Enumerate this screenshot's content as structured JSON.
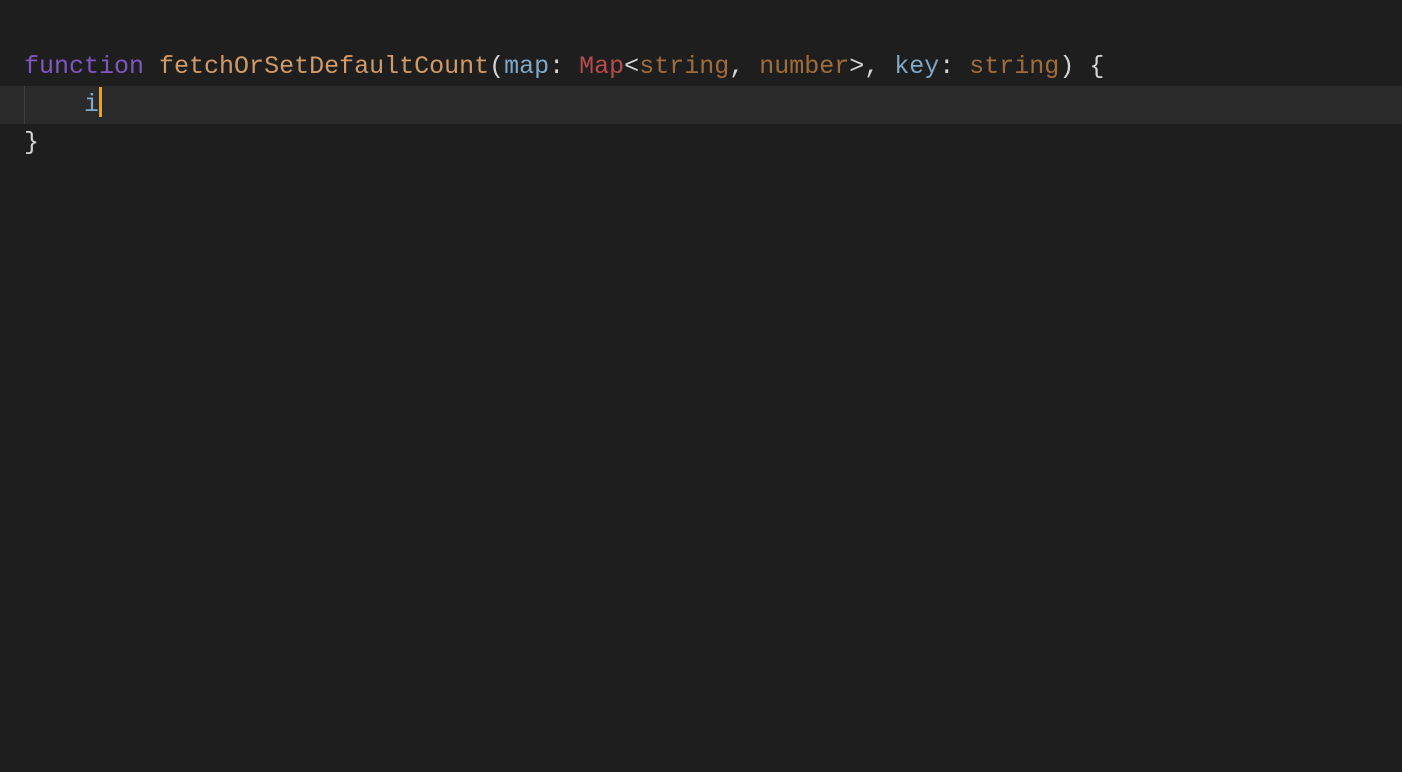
{
  "code": {
    "line1": {
      "keyword": "function",
      "space": " ",
      "funcname": "fetchOrSetDefaultCount",
      "open_paren": "(",
      "param1": "map",
      "colon1": ": ",
      "type1": "Map",
      "angle_open": "<",
      "gen1": "string",
      "gen_comma": ", ",
      "gen2": "number",
      "angle_close": ">",
      "comma": ", ",
      "param2": "key",
      "colon2": ": ",
      "type2": "string",
      "close_paren": ")",
      "brace_open": " {"
    },
    "line2": {
      "indent": "    ",
      "text": "i"
    },
    "line3": {
      "brace_close": "}"
    }
  }
}
